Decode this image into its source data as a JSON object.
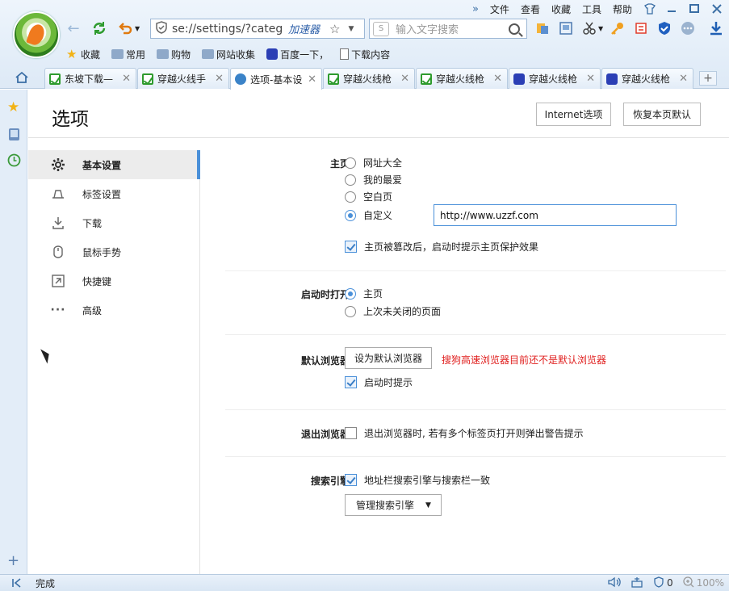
{
  "menu": {
    "items": [
      "文件",
      "查看",
      "收藏",
      "工具",
      "帮助"
    ]
  },
  "address": {
    "url": "se://settings/?categ",
    "accelerator": "加速器"
  },
  "search": {
    "placeholder": "输入文字搜索",
    "engine_icon": "sogou-search-icon"
  },
  "bookmarks": [
    {
      "label": "收藏",
      "icon": "star-icon"
    },
    {
      "label": "常用",
      "icon": "folder-icon"
    },
    {
      "label": "购物",
      "icon": "folder-icon"
    },
    {
      "label": "网站收集",
      "icon": "folder-icon"
    },
    {
      "label": "百度一下，",
      "icon": "paw-icon"
    },
    {
      "label": "下载内容",
      "icon": "page-icon"
    }
  ],
  "tabs": [
    {
      "label": "东坡下载—",
      "icon": "green-check"
    },
    {
      "label": "穿越火线手",
      "icon": "green-check"
    },
    {
      "label": "选项-基本设",
      "icon": "gear",
      "active": true
    },
    {
      "label": "穿越火线枪",
      "icon": "green-check"
    },
    {
      "label": "穿越火线枪",
      "icon": "green-check"
    },
    {
      "label": "穿越火线枪",
      "icon": "paw"
    },
    {
      "label": "穿越火线枪",
      "icon": "paw"
    }
  ],
  "page": {
    "title": "选项",
    "internet_btn": "Internet选项",
    "restore_btn": "恢复本页默认"
  },
  "sidenav": [
    {
      "label": "基本设置",
      "icon": "gear-icon",
      "active": true
    },
    {
      "label": "标签设置",
      "icon": "tab-icon"
    },
    {
      "label": "下载",
      "icon": "download-icon"
    },
    {
      "label": "鼠标手势",
      "icon": "mouse-icon"
    },
    {
      "label": "快捷键",
      "icon": "shortcut-icon"
    },
    {
      "label": "高级",
      "icon": "more-icon"
    }
  ],
  "homepage": {
    "label": "主页",
    "options": [
      "网址大全",
      "我的最爱",
      "空白页",
      "自定义"
    ],
    "selected": "自定义",
    "custom_url": "http://www.uzzf.com",
    "protect_label": "主页被篡改后，启动时提示主页保护效果",
    "protect_checked": true
  },
  "startup": {
    "label": "启动时打开",
    "options": [
      "主页",
      "上次未关闭的页面"
    ],
    "selected": "主页"
  },
  "default_browser": {
    "label": "默认浏览器",
    "button": "设为默认浏览器",
    "warning": "搜狗高速浏览器目前还不是默认浏览器",
    "prompt_label": "启动时提示",
    "prompt_checked": true
  },
  "exit": {
    "label": "退出浏览器",
    "option": "退出浏览器时, 若有多个标签页打开则弹出警告提示",
    "checked": false
  },
  "search_engine": {
    "label": "搜索引擎",
    "option": "地址栏搜索引擎与搜索栏一致",
    "checked": true,
    "manage_button": "管理搜索引擎"
  },
  "status": {
    "text": "完成",
    "adblock_count": "0",
    "zoom": "100%"
  },
  "colors": {
    "accent": "#4a90d9",
    "warning": "#e0201f"
  }
}
